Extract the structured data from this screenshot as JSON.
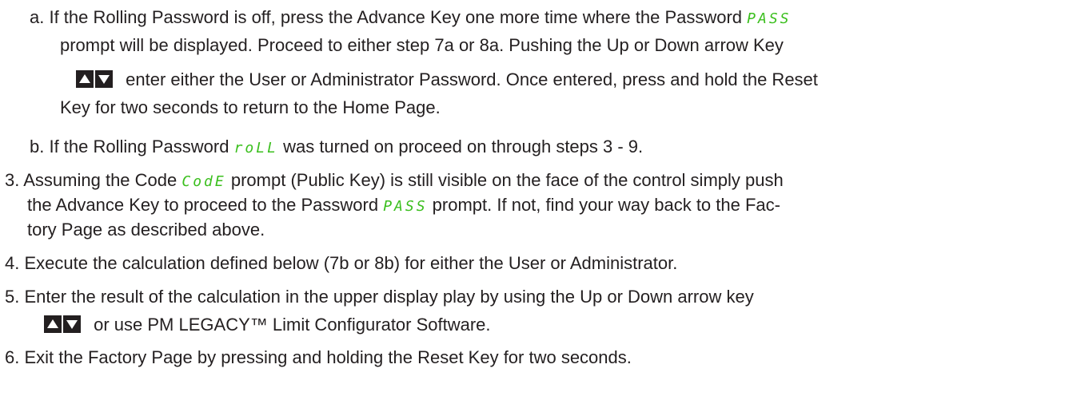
{
  "a": {
    "l1": "a. If the Rolling Password is off, press the Advance Key one more time where the Password",
    "l1_code": "PASS",
    "l2": "prompt will be displayed. Proceed to either step 7a or 8a. Pushing the Up or Down  arrow Key",
    "l3": "enter either the User or Administrator Password. Once entered, press and hold the Reset",
    "l4": "Key for two seconds to return to the Home Page."
  },
  "b": {
    "pre": "b. If the Rolling Password",
    "code": "roLL",
    "post": "was turned on proceed on through steps 3 - 9."
  },
  "s3": {
    "l1_pre": "3. Assuming the Code",
    "l1_code": "CodE",
    "l1_post": "prompt (Public Key) is still visible on the face of the control simply push",
    "l2_pre": "the Advance Key to proceed to the Password",
    "l2_code": "PASS",
    "l2_post": "prompt. If not, find your way back to the Fac-",
    "l3": "tory Page as described above."
  },
  "s4": "4. Execute the calculation defined below (7b or 8b) for either the User or Administrator.",
  "s5": {
    "l1": "5. Enter the result of the calculation in the upper display play by using the Up or Down arrow key",
    "l2": "or use PM LEGACY™ Limit Configurator Software."
  },
  "s6": "6. Exit the Factory Page by pressing and holding the Reset Key for two seconds.",
  "icons": [
    "up-arrow-key-icon",
    "down-arrow-key-icon"
  ],
  "colors": {
    "lcd_green": "#3bbf1e",
    "text": "#231f20"
  }
}
